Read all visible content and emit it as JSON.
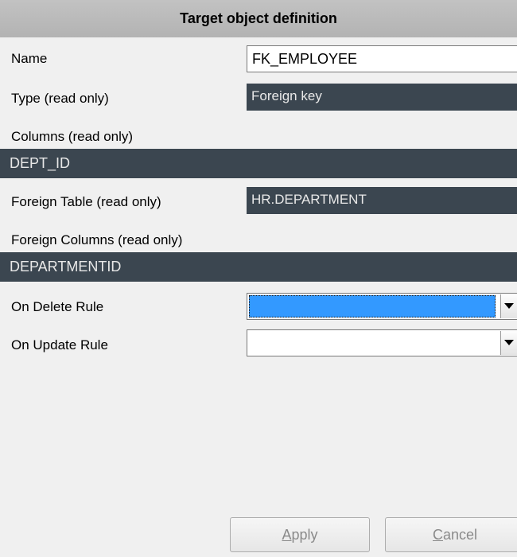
{
  "title": "Target object definition",
  "fields": {
    "name": {
      "label": "Name",
      "value": "FK_EMPLOYEE"
    },
    "type": {
      "label": "Type (read only)",
      "value": "Foreign key"
    },
    "columns": {
      "label": "Columns (read only)",
      "value": "DEPT_ID"
    },
    "foreign_table": {
      "label": "Foreign Table (read only)",
      "value": "HR.DEPARTMENT"
    },
    "foreign_columns": {
      "label": "Foreign Columns (read only)",
      "value": "DEPARTMENTID"
    },
    "on_delete_rule": {
      "label": "On Delete Rule",
      "value": ""
    },
    "on_update_rule": {
      "label": "On Update Rule",
      "value": ""
    }
  },
  "buttons": {
    "apply": {
      "mnemonic": "A",
      "rest": "pply"
    },
    "cancel": {
      "mnemonic": "C",
      "rest": "ancel"
    }
  },
  "icons": {
    "dropdown": "chevron-down-icon"
  },
  "colors": {
    "readonly_bg": "#3b4650",
    "selection_blue": "#3399ff",
    "title_bg": "#b8b8b8"
  }
}
